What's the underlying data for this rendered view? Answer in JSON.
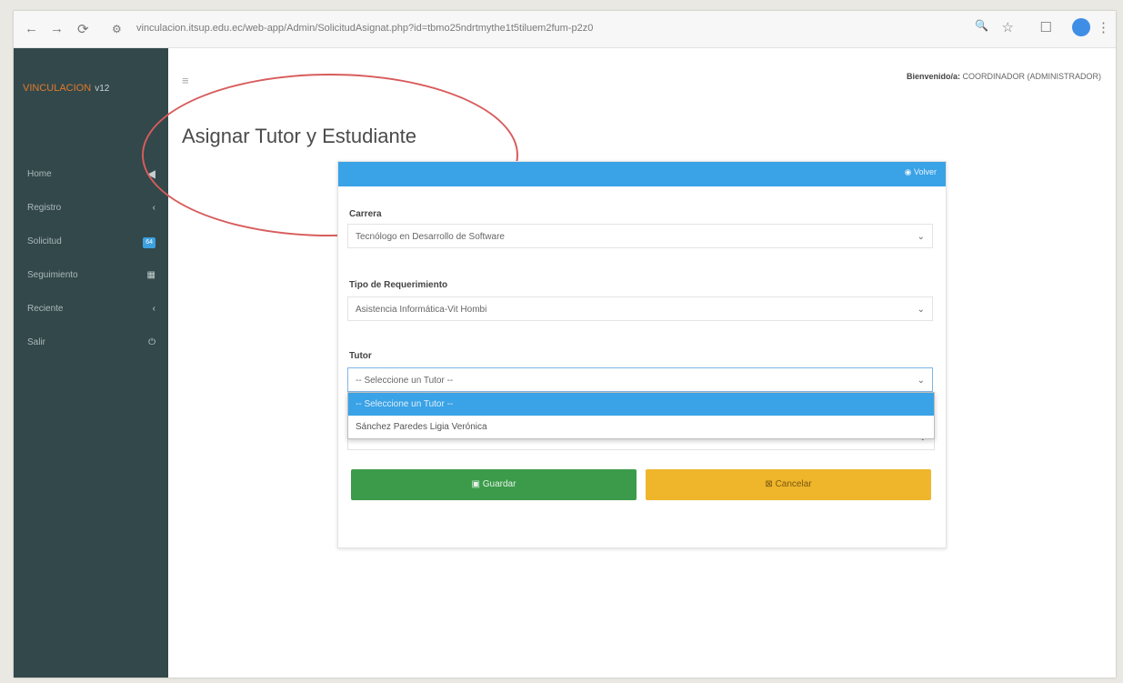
{
  "browser": {
    "url": "vinculacion.itsup.edu.ec/web-app/Admin/SolicitudAsignat.php?id=tbmo25ndrtmythe1t5tiluem2fum-p2z0",
    "back_icon": "←",
    "forward_icon": "→",
    "reload_icon": "⟳",
    "site_info_icon": "⚙",
    "zoom_icon": "🔍",
    "star_icon": "☆",
    "tab_icon": "☐",
    "menu_icon": "⋮"
  },
  "sidebar": {
    "brand": "VINCULACION",
    "version": "v12",
    "items": [
      {
        "label": "Home",
        "right": "◀"
      },
      {
        "label": "Registro",
        "right": "‹"
      },
      {
        "label": "Solicitud",
        "right": "64"
      },
      {
        "label": "Seguimiento",
        "right": "▦"
      },
      {
        "label": "Reciente",
        "right": "‹"
      },
      {
        "label": "Salir",
        "right": "⏻"
      }
    ]
  },
  "header": {
    "menu_toggle": "≡",
    "welcome_label": "Bienvenido/a:",
    "welcome_user": "COORDINADOR (ADMINISTRADOR)"
  },
  "page": {
    "title": "Asignar Tutor y Estudiante"
  },
  "card": {
    "back_label": "Volver",
    "back_icon": "◉",
    "carrera_label": "Carrera",
    "carrera_value": "Tecnólogo en Desarrollo de Software",
    "tipo_label": "Tipo de Requerimiento",
    "tipo_value": "Asistencia Informática-Vit Hombi",
    "tutor_label": "Tutor",
    "tutor_value": "-- Seleccione un Tutor --",
    "tutor_options": [
      "-- Seleccione un Tutor --",
      "Sánchez Paredes Ligia Verónica"
    ],
    "chevron": "⌄",
    "save_label": "Guardar",
    "save_icon": "▣",
    "cancel_label": "Cancelar",
    "cancel_icon": "⊠"
  },
  "colors": {
    "sidebar_bg": "#32484b",
    "accent_blue": "#3aa2e6",
    "save_green": "#3c9b4a",
    "cancel_yellow": "#efb52b",
    "annotation_red": "#d85c5c"
  }
}
